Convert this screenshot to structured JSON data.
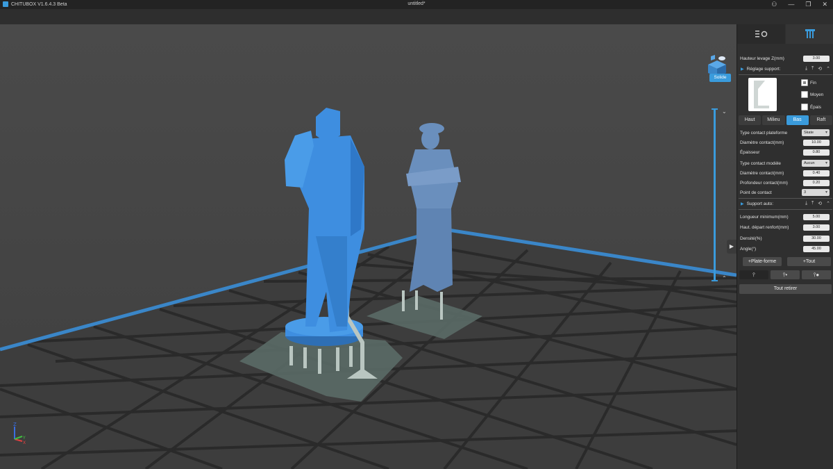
{
  "titlebar": {
    "app_name": "CHITUBOX V1.6.4.3 Beta",
    "document": "untitled*",
    "user_icon": "user-icon",
    "minimize": "—",
    "restore": "❐",
    "close": "✕"
  },
  "viewport": {
    "view_mode_button": "Solide",
    "accent_color": "#3a9bdc",
    "model_color": "#3e8ee0",
    "model2_color": "#6a8fbd",
    "support_color": "#b9c6c1"
  },
  "panel": {
    "tab_settings_icon": "settings-icon",
    "tab_support_icon": "support-icon",
    "lift_height": {
      "label": "Hauteur levage Z(mm)",
      "value": "3.00"
    },
    "support_settings": {
      "label": "Réglage support:"
    },
    "size_options": [
      "Fin",
      "Moyen",
      "Épais"
    ],
    "size_selected": "Fin",
    "segments": [
      "Haut",
      "Milieu",
      "Bas",
      "Raft"
    ],
    "segment_selected": "Bas",
    "fields": {
      "platform_contact_type": {
        "label": "Type contact plateforme",
        "value": "Skate"
      },
      "contact_diameter": {
        "label": "Diamètre contact(mm)",
        "value": "10.00"
      },
      "thickness": {
        "label": "Épaisseur",
        "value": "0.80"
      },
      "model_contact_type": {
        "label": "Type contact modèle",
        "value": "Aucun"
      },
      "contact_diameter2": {
        "label": "Diamètre contact(mm)",
        "value": "0.40"
      },
      "contact_depth": {
        "label": "Profondeur contact(mm)",
        "value": "0.20"
      },
      "contact_point": {
        "label": "Point de contact",
        "value": "3"
      }
    },
    "auto_support": {
      "label": "Support auto:",
      "min_length": {
        "label": "Longueur minimum(mm)",
        "value": "5.00"
      },
      "reinforce_height": {
        "label": "Haut. départ renfort(mm)",
        "value": "3.00"
      },
      "density": {
        "label": "Densité(%)",
        "value": "30.00"
      },
      "angle": {
        "label": "Angle(°)",
        "value": "45.00"
      }
    },
    "buttons": {
      "platform": "+Plate-forme",
      "all": "+Tout",
      "remove_all": "Tout retirer"
    }
  }
}
